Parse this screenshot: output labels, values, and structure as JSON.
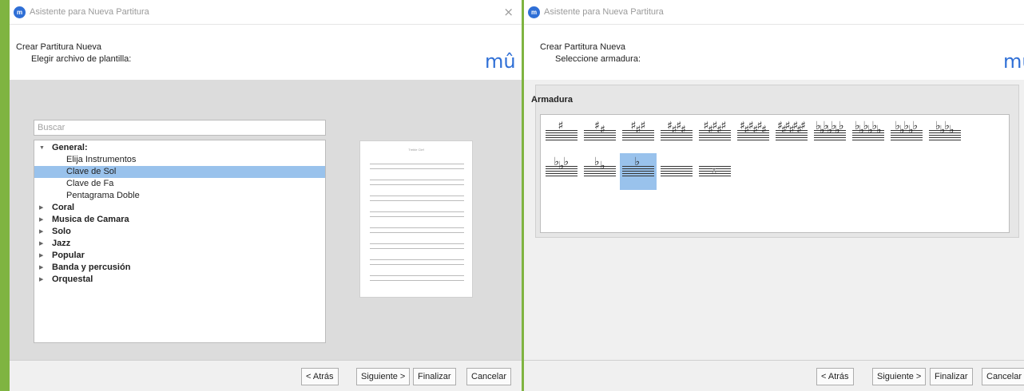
{
  "dialog_title": "Asistente para Nueva Partitura",
  "close_glyph": "×",
  "logo": "mû",
  "left_window": {
    "header_title": "Crear Partitura Nueva",
    "header_sub": "Elegir archivo de plantilla:",
    "search_placeholder": "Buscar",
    "tree": [
      {
        "label": "General:",
        "level": 0,
        "expanded": true,
        "bold": true,
        "selected": false
      },
      {
        "label": "Elija Instrumentos",
        "level": 1,
        "bold": false,
        "selected": false
      },
      {
        "label": "Clave de Sol",
        "level": 1,
        "bold": false,
        "selected": true
      },
      {
        "label": "Clave de Fa",
        "level": 1,
        "bold": false,
        "selected": false
      },
      {
        "label": "Pentagrama Doble",
        "level": 1,
        "bold": false,
        "selected": false
      },
      {
        "label": "Coral",
        "level": 0,
        "expanded": false,
        "bold": true,
        "selected": false
      },
      {
        "label": "Musica de Camara",
        "level": 0,
        "expanded": false,
        "bold": true,
        "selected": false
      },
      {
        "label": "Solo",
        "level": 0,
        "expanded": false,
        "bold": true,
        "selected": false
      },
      {
        "label": "Jazz",
        "level": 0,
        "expanded": false,
        "bold": true,
        "selected": false
      },
      {
        "label": "Popular",
        "level": 0,
        "expanded": false,
        "bold": true,
        "selected": false
      },
      {
        "label": "Banda y percusión",
        "level": 0,
        "expanded": false,
        "bold": true,
        "selected": false
      },
      {
        "label": "Orquestal",
        "level": 0,
        "expanded": false,
        "bold": true,
        "selected": false
      }
    ],
    "preview_title": "Treble Clef",
    "buttons": {
      "back": "< Atrás",
      "next": "Siguiente >",
      "finish": "Finalizar",
      "cancel": "Cancelar"
    }
  },
  "right_window": {
    "header_title": "Crear Partitura Nueva",
    "header_sub": "Seleccione armadura:",
    "section_title": "Armadura",
    "selected_signature": 13,
    "signatures": [
      {
        "accidental": "♯",
        "count": 1
      },
      {
        "accidental": "♯",
        "count": 2
      },
      {
        "accidental": "♯",
        "count": 3
      },
      {
        "accidental": "♯",
        "count": 4
      },
      {
        "accidental": "♯",
        "count": 5
      },
      {
        "accidental": "♯",
        "count": 6
      },
      {
        "accidental": "♯",
        "count": 7
      },
      {
        "accidental": "♭",
        "count": 7
      },
      {
        "accidental": "♭",
        "count": 6
      },
      {
        "accidental": "♭",
        "count": 5
      },
      {
        "accidental": "♭",
        "count": 4
      },
      {
        "accidental": "♭",
        "count": 3
      },
      {
        "accidental": "♭",
        "count": 2
      },
      {
        "accidental": "♭",
        "count": 1
      },
      {
        "accidental": "",
        "count": 0
      },
      {
        "accidental": "x",
        "count": 0
      }
    ],
    "buttons": {
      "back": "< Atrás",
      "next": "Siguiente >",
      "finish": "Finalizar",
      "cancel": "Cancelar"
    }
  }
}
